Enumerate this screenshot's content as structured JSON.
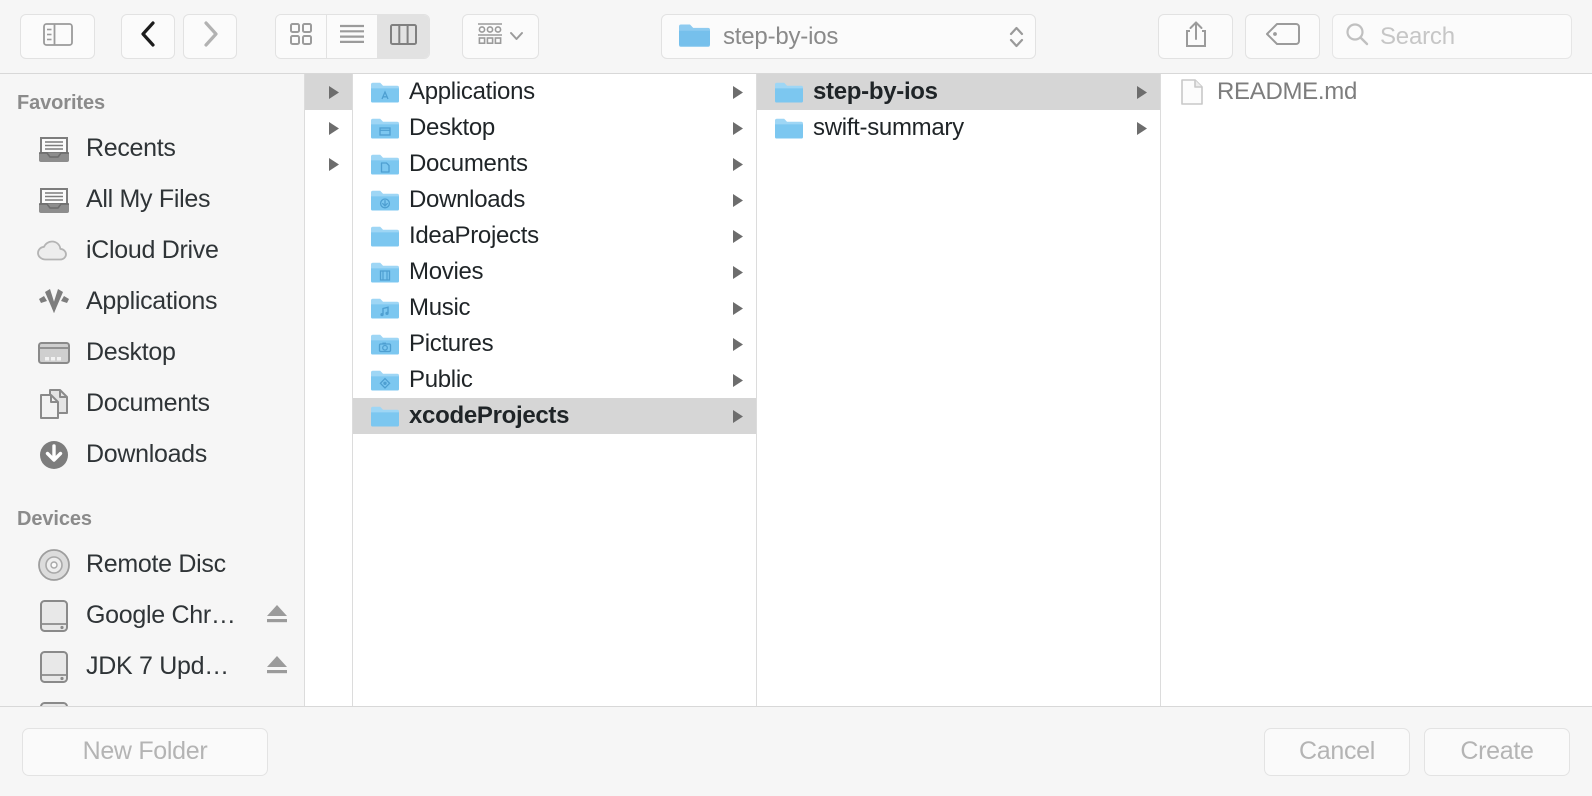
{
  "toolbar": {
    "sidebar_toggle": "sidebar-toggle",
    "back": "back",
    "forward": "forward",
    "view_icon": "icon-view",
    "view_list": "list-view",
    "view_column": "column-view",
    "arrange": "arrange",
    "path_label": "step-by-ios",
    "share": "share",
    "tag": "tag",
    "search_placeholder": "Search"
  },
  "sidebar": {
    "sections": [
      {
        "title": "Favorites",
        "items": [
          {
            "label": "Recents",
            "icon": "recents-icon",
            "eject": false
          },
          {
            "label": "All My Files",
            "icon": "all-my-files-icon",
            "eject": false
          },
          {
            "label": "iCloud Drive",
            "icon": "icloud-drive-icon",
            "eject": false
          },
          {
            "label": "Applications",
            "icon": "applications-icon",
            "eject": false
          },
          {
            "label": "Desktop",
            "icon": "desktop-icon",
            "eject": false
          },
          {
            "label": "Documents",
            "icon": "documents-icon",
            "eject": false
          },
          {
            "label": "Downloads",
            "icon": "downloads-icon",
            "eject": false
          }
        ]
      },
      {
        "title": "Devices",
        "items": [
          {
            "label": "Remote Disc",
            "icon": "optical-disc-icon",
            "eject": false
          },
          {
            "label": "Google Chr…",
            "icon": "external-drive-icon",
            "eject": true
          },
          {
            "label": "JDK 7 Upd…",
            "icon": "external-drive-icon",
            "eject": true
          },
          {
            "label": "",
            "icon": "external-drive-icon",
            "eject": false
          }
        ]
      }
    ]
  },
  "browser": {
    "partial_column": {
      "rows": [
        {
          "selected": true
        },
        {
          "selected": false
        },
        {
          "selected": false
        }
      ]
    },
    "column_1": {
      "rows": [
        {
          "label": "Applications",
          "icon": "folder-applications-icon",
          "selected": false,
          "chevron": true,
          "dim": false
        },
        {
          "label": "Desktop",
          "icon": "folder-desktop-icon",
          "selected": false,
          "chevron": true,
          "dim": false
        },
        {
          "label": "Documents",
          "icon": "folder-documents-icon",
          "selected": false,
          "chevron": true,
          "dim": false
        },
        {
          "label": "Downloads",
          "icon": "folder-downloads-icon",
          "selected": false,
          "chevron": true,
          "dim": false
        },
        {
          "label": "IdeaProjects",
          "icon": "folder-icon",
          "selected": false,
          "chevron": true,
          "dim": false
        },
        {
          "label": "Movies",
          "icon": "folder-movies-icon",
          "selected": false,
          "chevron": true,
          "dim": false
        },
        {
          "label": "Music",
          "icon": "folder-music-icon",
          "selected": false,
          "chevron": true,
          "dim": false
        },
        {
          "label": "Pictures",
          "icon": "folder-pictures-icon",
          "selected": false,
          "chevron": true,
          "dim": false
        },
        {
          "label": "Public",
          "icon": "folder-public-icon",
          "selected": false,
          "chevron": true,
          "dim": false
        },
        {
          "label": "xcodeProjects",
          "icon": "folder-icon",
          "selected": true,
          "chevron": true,
          "dim": false
        }
      ]
    },
    "column_2": {
      "rows": [
        {
          "label": "step-by-ios",
          "icon": "folder-icon",
          "selected": true,
          "chevron": true,
          "dim": false
        },
        {
          "label": "swift-summary",
          "icon": "folder-icon",
          "selected": false,
          "chevron": true,
          "dim": false
        }
      ]
    },
    "column_3": {
      "rows": [
        {
          "label": "README.md",
          "icon": "file-icon",
          "selected": false,
          "chevron": false,
          "dim": true
        }
      ]
    }
  },
  "bottombar": {
    "new_folder": "New Folder",
    "cancel": "Cancel",
    "create": "Create"
  },
  "colors": {
    "folder_blue": "#6bb9e8",
    "folder_blue_light": "#9ed6f5",
    "selection_gray": "#d6d6d6",
    "chrome_bg": "#f6f6f6"
  }
}
